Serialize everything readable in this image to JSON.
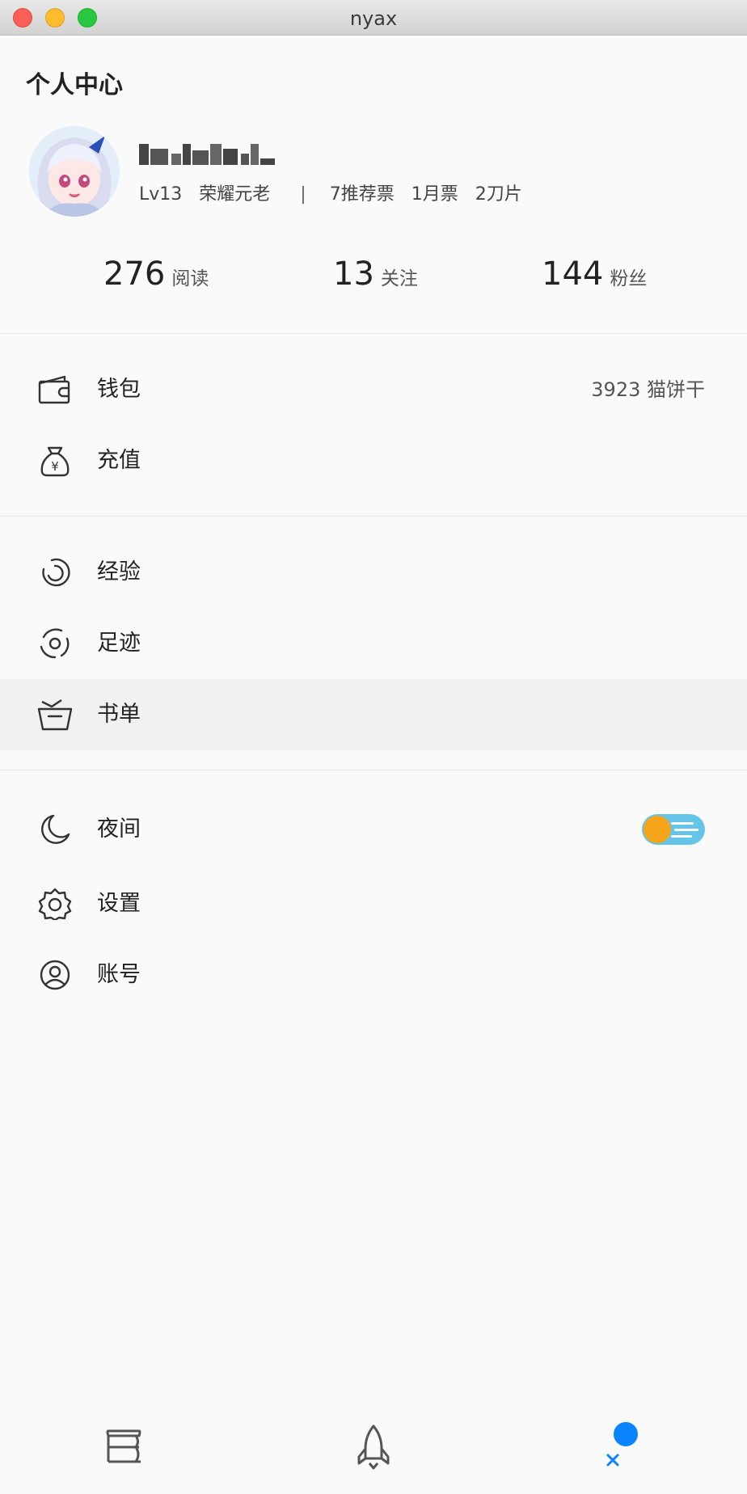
{
  "window": {
    "title": "nyax"
  },
  "page": {
    "title": "个人中心"
  },
  "profile": {
    "level": "Lv13",
    "rank": "荣耀元老",
    "separator": "|",
    "recommend_tickets": "7推荐票",
    "monthly_tickets": "1月票",
    "blades": "2刀片"
  },
  "stats": [
    {
      "value": "276",
      "label": "阅读"
    },
    {
      "value": "13",
      "label": "关注"
    },
    {
      "value": "144",
      "label": "粉丝"
    }
  ],
  "menu": {
    "wallet": {
      "label": "钱包",
      "value": "3923 猫饼干"
    },
    "recharge": {
      "label": "充值"
    },
    "experience": {
      "label": "经验"
    },
    "history": {
      "label": "足迹"
    },
    "booklist": {
      "label": "书单"
    },
    "night": {
      "label": "夜间",
      "enabled": true
    },
    "settings": {
      "label": "设置"
    },
    "account": {
      "label": "账号"
    }
  },
  "bottom_nav": {
    "items": [
      "bookshelf-icon",
      "rocket-icon",
      "profile-icon"
    ],
    "active": "profile-icon"
  },
  "colors": {
    "accent": "#0a84ff",
    "toggle_track": "#65c4e7",
    "toggle_knob": "#f6a51a"
  }
}
